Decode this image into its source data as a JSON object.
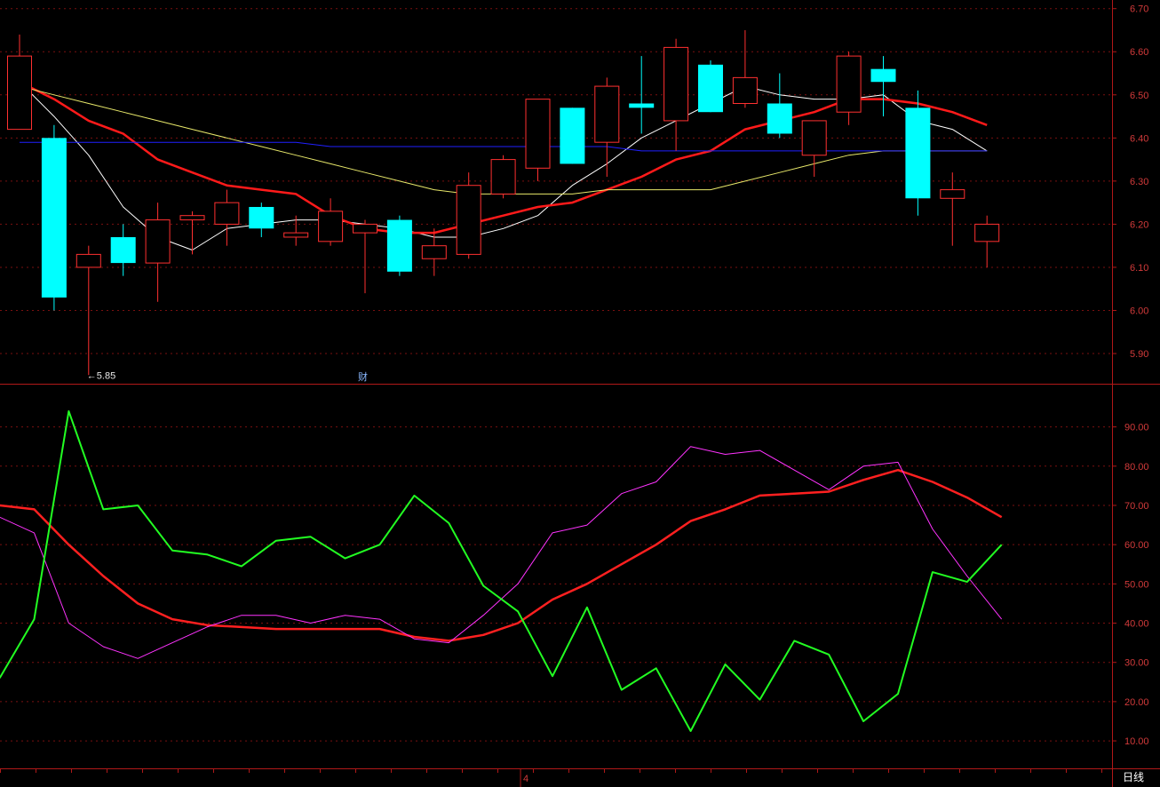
{
  "app": {
    "period_label": "日线",
    "finance_marker": "财",
    "low_marker": "←5.85"
  },
  "colors": {
    "background": "#000000",
    "grid": "#7a1010",
    "axis": "#b01818",
    "up": "#ff3030",
    "down": "#00ffff",
    "ma_white": "#ffffff",
    "ma_red": "#ff1a1a",
    "ma_yellow": "#e8e86a",
    "ma_blue": "#2020ff",
    "k_line": "#ff2020",
    "d_line": "#ff33ff",
    "j_line": "#22ff22"
  },
  "chart_data": [
    {
      "type": "candlestick",
      "ylim": [
        5.83,
        6.72
      ],
      "y_ticks": [
        "6.70",
        "6.60",
        "6.50",
        "6.40",
        "6.30",
        "6.20",
        "6.10",
        "6.00",
        "5.90"
      ],
      "x_ticks": [
        {
          "index": 14.5,
          "label": "4"
        }
      ],
      "low_annotation": {
        "index": 2,
        "value": 5.85
      },
      "finance_badge_index": 10,
      "candles": [
        {
          "o": 6.42,
          "h": 6.64,
          "l": 6.42,
          "c": 6.59
        },
        {
          "o": 6.4,
          "h": 6.43,
          "l": 6.0,
          "c": 6.03
        },
        {
          "o": 6.1,
          "h": 6.15,
          "l": 5.85,
          "c": 6.13
        },
        {
          "o": 6.17,
          "h": 6.2,
          "l": 6.08,
          "c": 6.11
        },
        {
          "o": 6.11,
          "h": 6.25,
          "l": 6.02,
          "c": 6.21
        },
        {
          "o": 6.21,
          "h": 6.23,
          "l": 6.13,
          "c": 6.22
        },
        {
          "o": 6.2,
          "h": 6.28,
          "l": 6.15,
          "c": 6.25
        },
        {
          "o": 6.24,
          "h": 6.25,
          "l": 6.17,
          "c": 6.19
        },
        {
          "o": 6.17,
          "h": 6.22,
          "l": 6.15,
          "c": 6.18
        },
        {
          "o": 6.16,
          "h": 6.26,
          "l": 6.15,
          "c": 6.23
        },
        {
          "o": 6.18,
          "h": 6.21,
          "l": 6.04,
          "c": 6.2
        },
        {
          "o": 6.21,
          "h": 6.22,
          "l": 6.08,
          "c": 6.09
        },
        {
          "o": 6.12,
          "h": 6.19,
          "l": 6.08,
          "c": 6.15
        },
        {
          "o": 6.13,
          "h": 6.32,
          "l": 6.12,
          "c": 6.29
        },
        {
          "o": 6.27,
          "h": 6.36,
          "l": 6.26,
          "c": 6.35
        },
        {
          "o": 6.33,
          "h": 6.49,
          "l": 6.3,
          "c": 6.49
        },
        {
          "o": 6.47,
          "h": 6.47,
          "l": 6.34,
          "c": 6.34
        },
        {
          "o": 6.39,
          "h": 6.54,
          "l": 6.31,
          "c": 6.52
        },
        {
          "o": 6.48,
          "h": 6.59,
          "l": 6.41,
          "c": 6.47
        },
        {
          "o": 6.44,
          "h": 6.63,
          "l": 6.37,
          "c": 6.61
        },
        {
          "o": 6.57,
          "h": 6.58,
          "l": 6.46,
          "c": 6.46
        },
        {
          "o": 6.48,
          "h": 6.65,
          "l": 6.47,
          "c": 6.54
        },
        {
          "o": 6.48,
          "h": 6.55,
          "l": 6.4,
          "c": 6.41
        },
        {
          "o": 6.36,
          "h": 6.44,
          "l": 6.31,
          "c": 6.44
        },
        {
          "o": 6.46,
          "h": 6.6,
          "l": 6.43,
          "c": 6.59
        },
        {
          "o": 6.56,
          "h": 6.59,
          "l": 6.45,
          "c": 6.53
        },
        {
          "o": 6.47,
          "h": 6.51,
          "l": 6.22,
          "c": 6.26
        },
        {
          "o": 6.26,
          "h": 6.32,
          "l": 6.15,
          "c": 6.28
        },
        {
          "o": 6.16,
          "h": 6.22,
          "l": 6.1,
          "c": 6.2
        }
      ],
      "series": [
        {
          "color_key": "ma_white",
          "values": [
            6.53,
            6.45,
            6.36,
            6.24,
            6.17,
            6.14,
            6.19,
            6.2,
            6.21,
            6.21,
            6.2,
            6.19,
            6.17,
            6.17,
            6.19,
            6.22,
            6.29,
            6.34,
            6.4,
            6.44,
            6.48,
            6.52,
            6.5,
            6.49,
            6.49,
            6.5,
            6.44,
            6.42,
            6.37
          ]
        },
        {
          "color_key": "ma_red",
          "values": [
            6.53,
            6.49,
            6.44,
            6.41,
            6.35,
            6.32,
            6.29,
            6.28,
            6.27,
            6.22,
            6.19,
            6.18,
            6.18,
            6.2,
            6.22,
            6.24,
            6.25,
            6.28,
            6.31,
            6.35,
            6.37,
            6.42,
            6.44,
            6.46,
            6.49,
            6.49,
            6.48,
            6.46,
            6.43
          ]
        },
        {
          "color_key": "ma_yellow",
          "values": [
            6.52,
            6.5,
            6.48,
            6.46,
            6.44,
            6.42,
            6.4,
            6.38,
            6.36,
            6.34,
            6.32,
            6.3,
            6.28,
            6.27,
            6.27,
            6.27,
            6.27,
            6.28,
            6.28,
            6.28,
            6.28,
            6.3,
            6.32,
            6.34,
            6.36,
            6.37,
            6.37,
            6.37,
            6.37
          ]
        },
        {
          "color_key": "ma_blue",
          "values": [
            6.39,
            6.39,
            6.39,
            6.39,
            6.39,
            6.39,
            6.39,
            6.39,
            6.39,
            6.38,
            6.38,
            6.38,
            6.38,
            6.38,
            6.38,
            6.38,
            6.38,
            6.38,
            6.37,
            6.37,
            6.37,
            6.37,
            6.37,
            6.37,
            6.37,
            6.37,
            6.37,
            6.37,
            6.37
          ]
        }
      ]
    },
    {
      "type": "line",
      "ylim": [
        3,
        101
      ],
      "y_ticks": [
        "90.00",
        "80.00",
        "70.00",
        "60.00",
        "50.00",
        "40.00",
        "30.00",
        "20.00",
        "10.00"
      ],
      "series": [
        {
          "color_key": "k_line",
          "values": [
            70,
            69,
            60,
            52,
            45,
            41,
            39.5,
            39,
            38.5,
            38.5,
            38.5,
            38.5,
            36.5,
            35.5,
            37,
            40,
            46,
            50,
            55,
            60,
            66,
            69,
            72.5,
            73,
            73.5,
            76.5,
            79,
            76,
            72,
            67
          ]
        },
        {
          "color_key": "d_line",
          "values": [
            67,
            63,
            40,
            34,
            31,
            35,
            39,
            42,
            42,
            40,
            42,
            41,
            36,
            35,
            42,
            50,
            63,
            65,
            73,
            76,
            85,
            83,
            84,
            79,
            74,
            80,
            81,
            64,
            52,
            41
          ]
        },
        {
          "color_key": "j_line",
          "values": [
            26,
            41,
            94,
            69,
            70,
            58.5,
            57.5,
            54.5,
            61,
            62,
            56.5,
            60,
            72.5,
            65.5,
            49.5,
            43,
            26.5,
            44,
            23,
            28.5,
            12.5,
            29.5,
            20.5,
            35.5,
            32,
            15,
            22,
            53,
            50.5,
            60
          ]
        }
      ]
    }
  ]
}
